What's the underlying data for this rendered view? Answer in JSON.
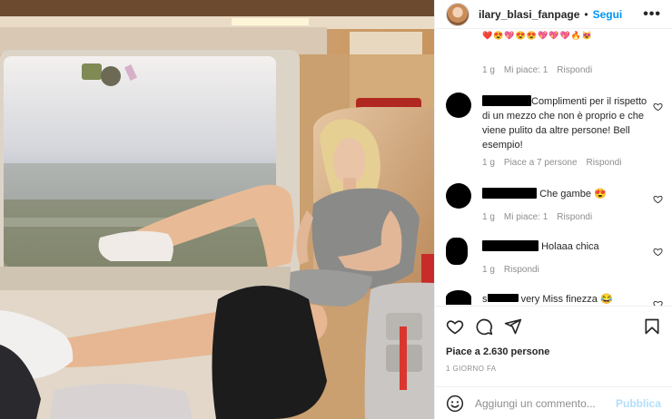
{
  "post": {
    "username": "ilary_blasi_fanpage",
    "separator": "•",
    "follow_label": "Segui",
    "more_label": "•••"
  },
  "comments": [
    {
      "text": "",
      "emoji_line": "❤️😍💖😍😍💖💖💖🔥😻",
      "time": "1 g",
      "likes": "Mi piace: 1",
      "reply": "Rispondi"
    },
    {
      "text": "Complimenti per il rispetto di un mezzo che non è proprio e che viene pulito da altre persone! Bell esempio!",
      "time": "1 g",
      "likes": "Piace a 7 persone",
      "reply": "Rispondi"
    },
    {
      "text": "Che gambe 😍",
      "time": "1 g",
      "likes": "Mi piace: 1",
      "reply": "Rispondi"
    },
    {
      "text": "Holaaa chica",
      "time": "1 g",
      "likes": "",
      "reply": "Rispondi"
    },
    {
      "text_prefix": "s",
      "text": "very Miss finezza 😂"
    }
  ],
  "footer": {
    "likes_text": "Piace a 2.630 persone",
    "date_text": "1 GIORNO FA",
    "comment_placeholder": "Aggiungi un commento...",
    "publish_label": "Pubblica"
  },
  "icons": {
    "like": "heart-icon",
    "comment": "comment-icon",
    "share": "send-icon",
    "save": "bookmark-icon",
    "emoji": "smile-icon",
    "more": "more-icon"
  },
  "colors": {
    "accent": "#0095f6",
    "publish_disabled": "#b2dffc",
    "muted": "#8e8e8e",
    "text": "#262626"
  }
}
